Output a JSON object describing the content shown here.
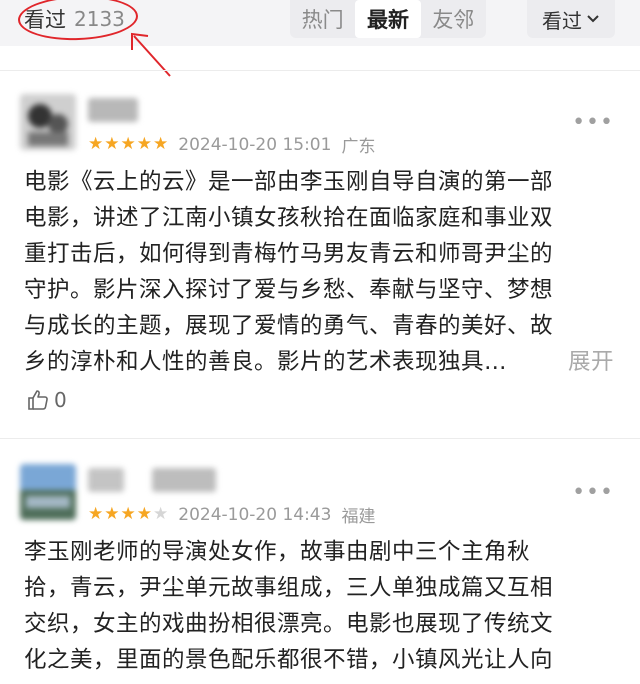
{
  "header": {
    "watched_label": "看过",
    "watched_count": "2133",
    "tabs": [
      {
        "label": "热门",
        "active": false
      },
      {
        "label": "最新",
        "active": true
      },
      {
        "label": "友邻",
        "active": false
      }
    ],
    "filter_label": "看过"
  },
  "reviews": [
    {
      "rating": 5,
      "datetime": "2024-10-20 15:01",
      "location": "广东",
      "lines": [
        "电影《云上的云》是一部由李玉刚自导自演的第一部",
        "电影，讲述了江南小镇女孩秋拾在面临家庭和事业双",
        "重打击后，如何得到青梅竹马男友青云和师哥尹尘的",
        "守护。影片深入探讨了爱与乡愁、奉献与坚守、梦想",
        "与成长的主题，展现了爱情的勇气、青春的美好、故",
        "乡的淳朴和人性的善良。影片的艺术表现独具…"
      ],
      "expand_label": "展开",
      "likes": "0"
    },
    {
      "rating": 4,
      "datetime": "2024-10-20 14:43",
      "location": "福建",
      "lines": [
        "李玉刚老师的导演处女作，故事由剧中三个主角秋",
        "拾，青云，尹尘单元故事组成，三人单独成篇又互相",
        "交织，女主的戏曲扮相很漂亮。电影也展现了传统文",
        "化之美，里面的景色配乐都很不错，小镇风光让人向"
      ]
    }
  ],
  "colors": {
    "star": "#f6a623",
    "annotation": "#e0262b"
  }
}
